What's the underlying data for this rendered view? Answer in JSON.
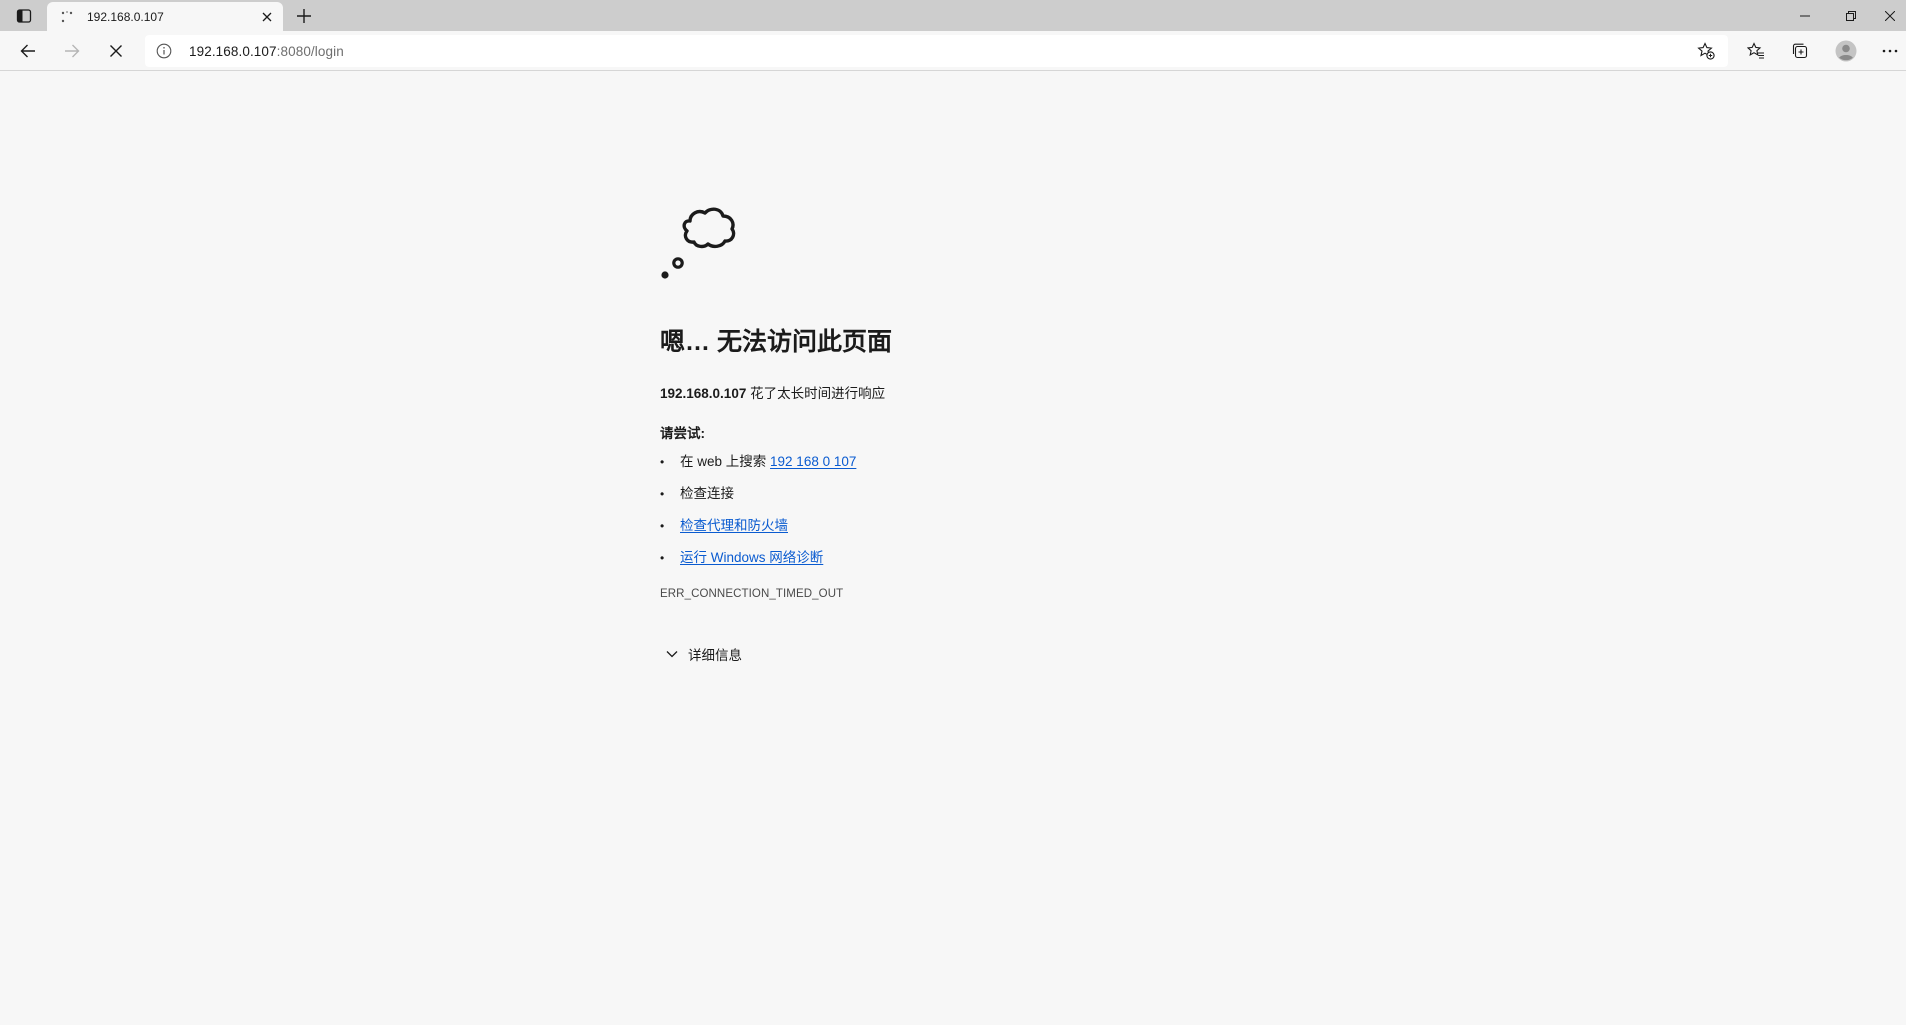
{
  "tab": {
    "title": "192.168.0.107"
  },
  "toolbar": {
    "url_host": "192.168.0.107",
    "url_path": ":8080/login"
  },
  "error": {
    "heading": "嗯… 无法访问此页面",
    "host": "192.168.0.107",
    "reason_suffix": " 花了太长时间进行响应",
    "try_title": "请尝试:",
    "suggestions": {
      "search_prefix": "在 web 上搜索 ",
      "search_link": "192 168 0 107",
      "check_connection": "检查连接",
      "check_proxy": "检查代理和防火墙",
      "run_diagnostics": "运行 Windows 网络诊断"
    },
    "code": "ERR_CONNECTION_TIMED_OUT",
    "details_label": "详细信息"
  },
  "icons": {
    "tab_actions": "tab-actions-icon",
    "loading": "loading-spinner-icon",
    "close": "close-icon",
    "new_tab": "plus-icon",
    "back": "back-arrow-icon",
    "forward": "forward-arrow-icon",
    "stop": "stop-icon",
    "info": "info-icon",
    "add_favorite": "star-add-icon",
    "favorites": "favorites-icon",
    "collections": "collections-icon",
    "profile": "profile-icon",
    "more": "ellipsis-icon",
    "error": "thought-cloud-icon",
    "expand": "chevron-down-icon"
  },
  "colors": {
    "link": "#0a5bd0",
    "page_bg": "#f7f7f7",
    "tabstrip_bg": "#cdcdcd"
  }
}
